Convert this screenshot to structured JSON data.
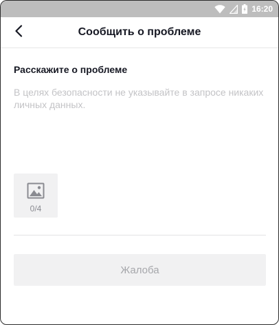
{
  "status_bar": {
    "time": "16:20",
    "icons": [
      "wifi-icon",
      "signal-icon",
      "battery-icon"
    ],
    "background": "#bdbdbd"
  },
  "header": {
    "title": "Сообщить о проблеме",
    "back_icon": "chevron-left-icon"
  },
  "form": {
    "section_title": "Расскажите о проблеме",
    "description": {
      "value": "",
      "placeholder": "В целях безопасности не указывайте в запросе никаких личных данных."
    },
    "image_upload": {
      "icon": "image-icon",
      "count": "0/4"
    },
    "submit_label": "Жалоба"
  },
  "colors": {
    "text_primary": "#161823",
    "placeholder": "#c3c3c6",
    "disabled_button_bg": "#f1f1f2",
    "disabled_button_text": "#a6a7ab"
  }
}
